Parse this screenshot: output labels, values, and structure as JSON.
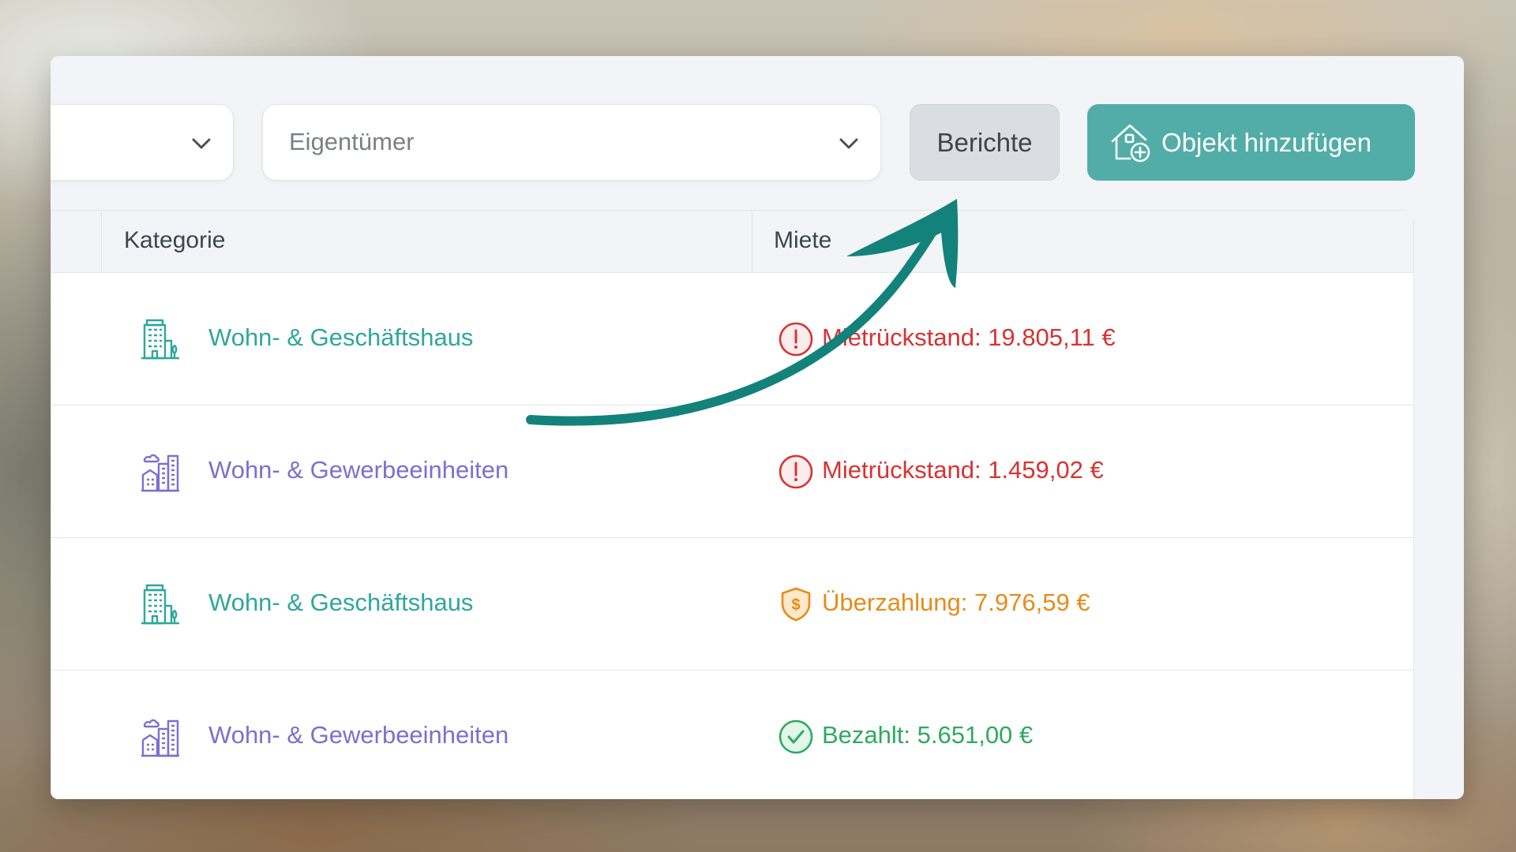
{
  "toolbar": {
    "filter_placeholder": "",
    "owner_placeholder": "Eigentümer",
    "reports_label": "Berichte",
    "add_label": "Objekt hinzufügen"
  },
  "table": {
    "headers": {
      "category": "Kategorie",
      "rent": "Miete"
    },
    "rows": [
      {
        "category": "Wohn- & Geschäftshaus",
        "category_icon": "office-building-icon",
        "status": "Mietrückstand: 19.805,11 €",
        "status_icon": "alert-circle-icon",
        "status_color": "#d83232"
      },
      {
        "category": "Wohn- & Gewerbeeinheiten",
        "category_icon": "city-buildings-icon",
        "status": "Mietrückstand: 1.459,02 €",
        "status_icon": "alert-circle-icon",
        "status_color": "#d83232"
      },
      {
        "category": "Wohn- & Geschäftshaus",
        "category_icon": "office-building-icon",
        "status": "Überzahlung: 7.976,59 €",
        "status_icon": "dollar-shield-icon",
        "status_color": "#e88a1a"
      },
      {
        "category": "Wohn- & Gewerbeeinheiten",
        "category_icon": "city-buildings-icon",
        "status": "Bezahlt: 5.651,00 €",
        "status_icon": "check-circle-icon",
        "status_color": "#2eaa5f"
      }
    ]
  },
  "colors": {
    "accent": "#52ada8",
    "teal_text": "#2ea79c",
    "purple_text": "#7d6fd1",
    "arrow": "#13827b"
  }
}
